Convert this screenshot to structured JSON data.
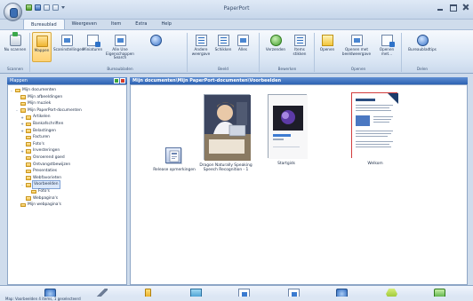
{
  "window": {
    "title": "PaperPort"
  },
  "ribbon": {
    "tabs": [
      "Bureaublad",
      "Weergeven",
      "Item",
      "Extra",
      "Help"
    ],
    "buttons": [
      {
        "label": "Nu scannen",
        "icon": "scan-icon"
      },
      {
        "label": "Mappen",
        "icon": "folder-icon"
      },
      {
        "label": "Scaninstellingen",
        "icon": "scan-settings-icon"
      },
      {
        "label": "Miniaturen",
        "icon": "thumbnails-icon"
      },
      {
        "label": "Alle Une Eigenschappen Search",
        "icon": "search-properties-icon"
      },
      {
        "label": "Andere weergave",
        "icon": "view-icon"
      },
      {
        "label": "Schikken",
        "icon": "arrange-icon"
      },
      {
        "label": "Alles",
        "icon": "select-all-icon"
      },
      {
        "label": "Verzenden",
        "icon": "send-icon"
      },
      {
        "label": "Items stikken",
        "icon": "stack-icon"
      },
      {
        "label": "Openen",
        "icon": "open-icon"
      },
      {
        "label": "Openen met beeldweergave",
        "icon": "open-image-view-icon"
      },
      {
        "label": "Openen met...",
        "icon": "open-with-icon"
      },
      {
        "label": "Bureaubladtips",
        "icon": "tips-icon"
      }
    ],
    "groups": [
      "Scannen",
      "Bureaubladen",
      "Beeld",
      "Bewerken",
      "Openen",
      "Delen"
    ]
  },
  "left_pane": {
    "header": "Mappen",
    "tree": [
      {
        "label": "Mijn documenten",
        "level": 0,
        "expander": "-"
      },
      {
        "label": "Mijn afbeeldingen",
        "level": 1,
        "expander": ""
      },
      {
        "label": "Mijn muziek",
        "level": 1,
        "expander": ""
      },
      {
        "label": "Mijn PaperPort-documenten",
        "level": 1,
        "expander": "-"
      },
      {
        "label": "Artikelen",
        "level": 2,
        "expander": "+"
      },
      {
        "label": "Bankafschriften",
        "level": 2,
        "expander": "+"
      },
      {
        "label": "Belastingen",
        "level": 2,
        "expander": "+"
      },
      {
        "label": "Facturen",
        "level": 2,
        "expander": ""
      },
      {
        "label": "Foto's",
        "level": 2,
        "expander": ""
      },
      {
        "label": "Investeringen",
        "level": 2,
        "expander": "+"
      },
      {
        "label": "Onroerend goed",
        "level": 2,
        "expander": ""
      },
      {
        "label": "Ontvangstbewijzen",
        "level": 2,
        "expander": ""
      },
      {
        "label": "Presentaties",
        "level": 2,
        "expander": ""
      },
      {
        "label": "Webfavorieten",
        "level": 2,
        "expander": ""
      },
      {
        "label": "Voorbeelden",
        "level": 2,
        "expander": "-",
        "selected": true
      },
      {
        "label": "Foto's",
        "level": 3,
        "expander": ""
      },
      {
        "label": "Webpagina's",
        "level": 2,
        "expander": ""
      },
      {
        "label": "Mijn webpagina's",
        "level": 1,
        "expander": ""
      }
    ]
  },
  "main": {
    "path": "Mijn documenten\\Mijn PaperPort-documenten\\Voorbeelden",
    "items": [
      {
        "label": "Release opmerkingen",
        "type": "release-notes"
      },
      {
        "label": "Dragon Naturally Speaking Speech Recognition - 1",
        "type": "photo"
      },
      {
        "label": "Startgids",
        "type": "guide"
      },
      {
        "label": "Welkom",
        "type": "welcome"
      }
    ]
  },
  "bottom_bar": {
    "icons": [
      "scan-send-icon",
      "pen-icon",
      "marker-icon",
      "image-icon",
      "edit-icon",
      "pdf-icon",
      "settings-icon",
      "hex-icon",
      "recycle-icon"
    ]
  },
  "status": {
    "text": "Map: Voorbeelden 4 items, 1 geselecteerd"
  },
  "colors": {
    "title_gradient_top": "#dfe9f6",
    "header_blue": "#2d62b3",
    "selection_orange": "#ffd274"
  }
}
